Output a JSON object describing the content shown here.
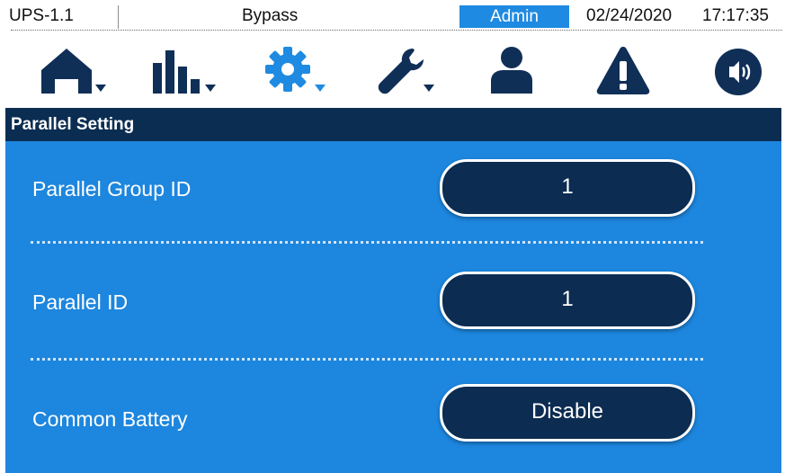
{
  "status_bar": {
    "model": "UPS-1.1",
    "mode": "Bypass",
    "user": "Admin",
    "date": "02/24/2020",
    "time": "17:17:35"
  },
  "toolbar": {
    "items": [
      {
        "name": "home",
        "icon": "home-icon"
      },
      {
        "name": "measurements",
        "icon": "bar-chart-icon"
      },
      {
        "name": "settings",
        "icon": "gear-icon"
      },
      {
        "name": "maintenance",
        "icon": "wrench-icon"
      },
      {
        "name": "user",
        "icon": "user-icon"
      },
      {
        "name": "alarm",
        "icon": "warning-icon"
      },
      {
        "name": "sound",
        "icon": "speaker-icon"
      }
    ]
  },
  "page": {
    "title": "Parallel Setting"
  },
  "settings": [
    {
      "label": "Parallel Group ID",
      "value": "1"
    },
    {
      "label": "Parallel ID",
      "value": "1"
    },
    {
      "label": "Common Battery",
      "value": "Disable"
    }
  ],
  "colors": {
    "panel_blue": "#1d86de",
    "navy": "#0b2d52",
    "icon_navy": "#0f2f57",
    "settings_icon_active": "#1f8ae1"
  }
}
